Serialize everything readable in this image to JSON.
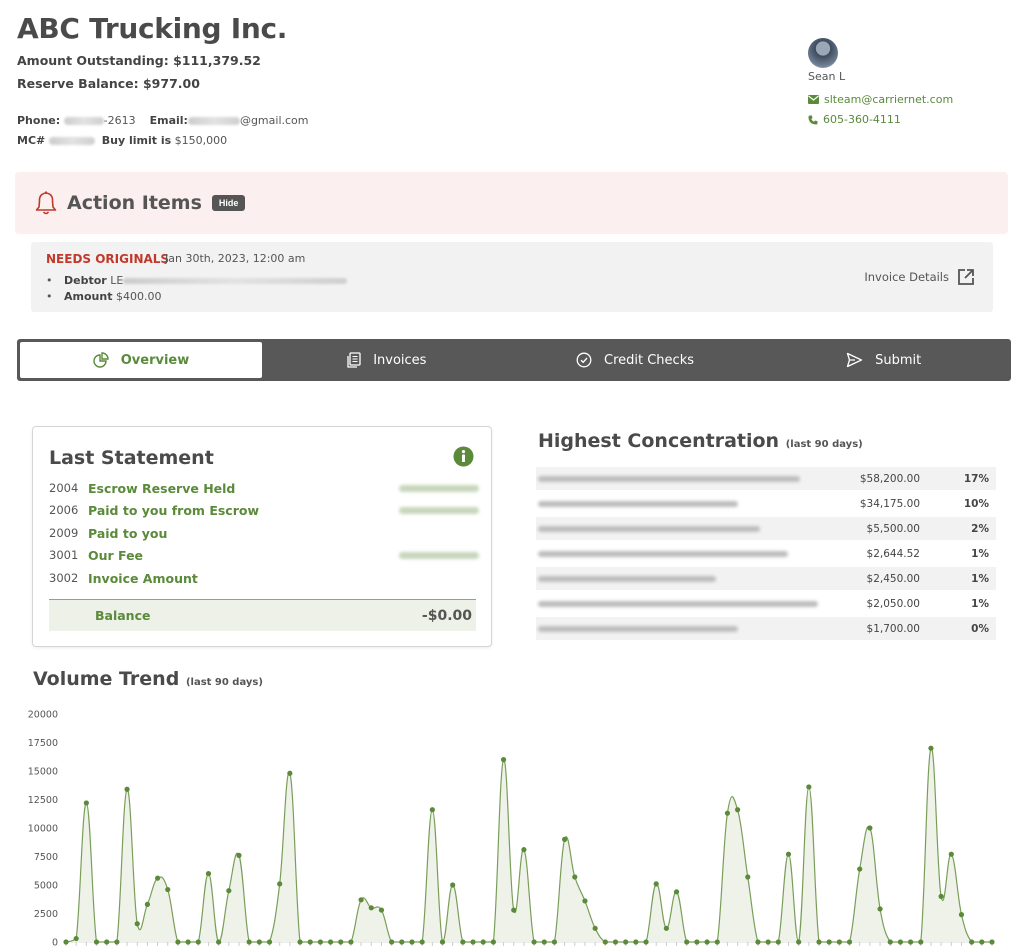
{
  "header": {
    "company": "ABC Trucking Inc.",
    "amount_outstanding": "Amount Outstanding: $111,379.52",
    "reserve_balance": "Reserve Balance: $977.00",
    "phone_label": "Phone:",
    "phone_suffix": "-2613",
    "email_label": "Email:",
    "email_suffix": "@gmail.com",
    "mc_label": "MC#",
    "buy_limit_label": "Buy limit is",
    "buy_limit_value": "$150,000"
  },
  "rep": {
    "name": "Sean L",
    "email": "slteam@carriernet.com",
    "phone": "605-360-4111"
  },
  "action_items": {
    "title": "Action Items",
    "hide_label": "Hide",
    "item": {
      "status": "NEEDS ORIGINALS",
      "date": "Jan 30th, 2023, 12:00 am",
      "debtor_label": "Debtor",
      "debtor_prefix": "LE",
      "amount_label": "Amount",
      "amount_value": "$400.00",
      "details_link": "Invoice Details"
    }
  },
  "tabs": [
    {
      "label": "Overview",
      "icon": "pie-chart-icon"
    },
    {
      "label": "Invoices",
      "icon": "documents-icon"
    },
    {
      "label": "Credit Checks",
      "icon": "check-circle-icon"
    },
    {
      "label": "Submit",
      "icon": "send-icon"
    }
  ],
  "last_statement": {
    "title": "Last Statement",
    "rows": [
      {
        "code": "2004",
        "label": "Escrow Reserve Held"
      },
      {
        "code": "2006",
        "label": "Paid to you from Escrow"
      },
      {
        "code": "2009",
        "label": "Paid to you"
      },
      {
        "code": "3001",
        "label": "Our Fee"
      },
      {
        "code": "3002",
        "label": "Invoice Amount"
      }
    ],
    "balance_label": "Balance",
    "balance_value": "-$0.00"
  },
  "concentration": {
    "title": "Highest Concentration",
    "subtitle": "(last 90 days)",
    "rows": [
      {
        "amount": "$58,200.00",
        "pct": "17%"
      },
      {
        "amount": "$34,175.00",
        "pct": "10%"
      },
      {
        "amount": "$5,500.00",
        "pct": "2%"
      },
      {
        "amount": "$2,644.52",
        "pct": "1%"
      },
      {
        "amount": "$2,450.00",
        "pct": "1%"
      },
      {
        "amount": "$2,050.00",
        "pct": "1%"
      },
      {
        "amount": "$1,700.00",
        "pct": "0%"
      }
    ]
  },
  "volume_trend": {
    "title": "Volume Trend",
    "subtitle": "(last 90 days)"
  },
  "colors": {
    "accent_green": "#5a8a3a",
    "alert_red": "#c0392b",
    "tab_bar": "#585858",
    "action_bg": "#fbeff0"
  },
  "chart_data": {
    "type": "area",
    "ylim": [
      0,
      20000
    ],
    "yticks": [
      0,
      2500,
      5000,
      7500,
      10000,
      12500,
      15000,
      17500,
      20000
    ],
    "values": [
      0,
      300,
      12200,
      0,
      0,
      0,
      13400,
      1600,
      3300,
      5600,
      4600,
      0,
      0,
      0,
      6000,
      0,
      4500,
      7600,
      0,
      0,
      0,
      5100,
      14800,
      0,
      0,
      0,
      0,
      0,
      0,
      3700,
      3000,
      2800,
      0,
      0,
      0,
      0,
      11600,
      0,
      5000,
      0,
      0,
      0,
      0,
      16000,
      2800,
      8100,
      0,
      0,
      0,
      9000,
      5700,
      3600,
      1200,
      0,
      0,
      0,
      0,
      0,
      5100,
      1200,
      4400,
      0,
      0,
      0,
      0,
      11300,
      11600,
      5700,
      0,
      0,
      0,
      7700,
      0,
      13600,
      0,
      0,
      0,
      0,
      6400,
      10000,
      2900,
      0,
      0,
      0,
      0,
      17000,
      4000,
      7700,
      2400,
      0,
      0,
      0
    ]
  }
}
